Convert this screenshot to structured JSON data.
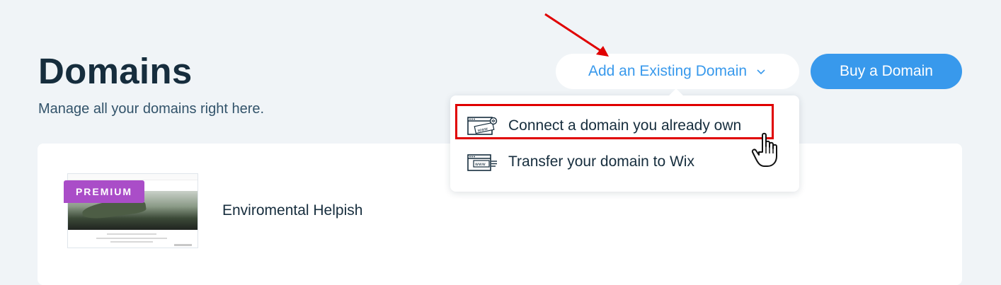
{
  "header": {
    "title": "Domains",
    "subtitle": "Manage all your domains right here."
  },
  "actions": {
    "add_existing_label": "Add an Existing Domain",
    "buy_label": "Buy a Domain"
  },
  "dropdown": {
    "items": [
      {
        "label": "Connect a domain you already own",
        "icon": "browser-www-connect-icon"
      },
      {
        "label": "Transfer your domain to Wix",
        "icon": "browser-www-transfer-icon"
      }
    ]
  },
  "sites": [
    {
      "name": "Enviromental Helpish",
      "badge": "PREMIUM"
    }
  ],
  "colors": {
    "background": "#f0f4f7",
    "accent": "#3899ec",
    "premium": "#aa4dc8",
    "annotation": "#e00000"
  }
}
